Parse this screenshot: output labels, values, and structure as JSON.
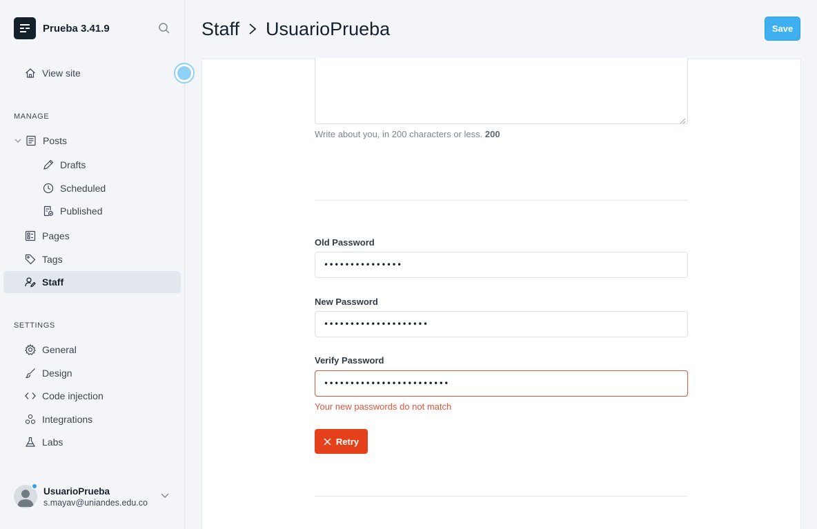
{
  "app": {
    "site_title": "Prueba 3.41.9"
  },
  "sidebar": {
    "view_site": "View site",
    "manage_title": "MANAGE",
    "settings_title": "SETTINGS",
    "manage_items": [
      {
        "label": "Posts",
        "icon": "posts-icon"
      },
      {
        "label": "Drafts",
        "icon": "pencil-icon"
      },
      {
        "label": "Scheduled",
        "icon": "clock-icon"
      },
      {
        "label": "Published",
        "icon": "published-icon"
      },
      {
        "label": "Pages",
        "icon": "pages-icon"
      },
      {
        "label": "Tags",
        "icon": "tag-icon"
      },
      {
        "label": "Staff",
        "icon": "staff-icon",
        "active": true
      }
    ],
    "settings_items": [
      {
        "label": "General",
        "icon": "gear-icon"
      },
      {
        "label": "Design",
        "icon": "brush-icon"
      },
      {
        "label": "Code injection",
        "icon": "code-icon"
      },
      {
        "label": "Integrations",
        "icon": "integrations-icon"
      },
      {
        "label": "Labs",
        "icon": "flask-icon"
      }
    ],
    "user": {
      "name": "UsuarioPrueba",
      "email": "s.mayav@uniandes.edu.co"
    }
  },
  "header": {
    "crumb_parent": "Staff",
    "crumb_current": "UsuarioPrueba",
    "save_label": "Save"
  },
  "bio": {
    "hint": "Write about you, in 200 characters or less.",
    "count": "200"
  },
  "password": {
    "old_label": "Old Password",
    "old_value": "•••••••••••••••",
    "new_label": "New Password",
    "new_value": "••••••••••••••••••••",
    "verify_label": "Verify Password",
    "verify_value": "••••••••••••••••••••••••",
    "error": "Your new passwords do not match",
    "retry_label": "Retry"
  },
  "colors": {
    "accent": "#3eb0ef",
    "error": "#e3401b",
    "sidebar_bg": "#f4f5f8"
  }
}
